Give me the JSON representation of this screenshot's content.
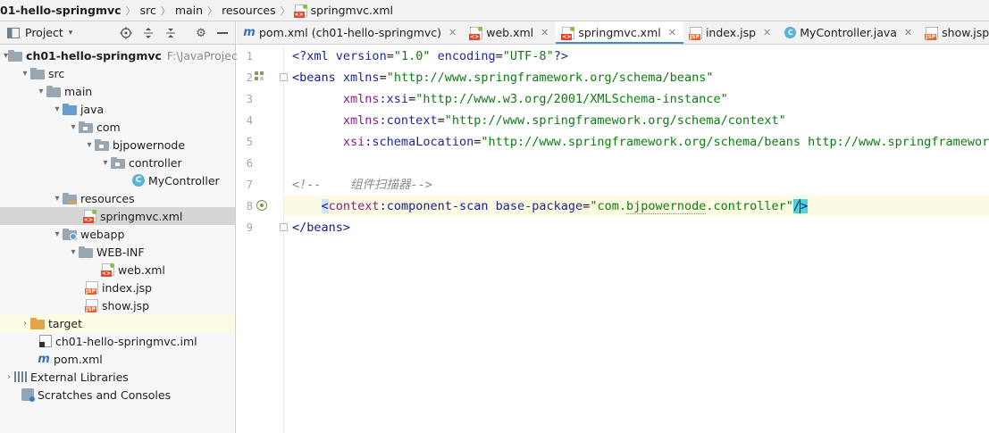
{
  "breadcrumbs": [
    {
      "label": "01-hello-springmvc",
      "icon": "module-folder-icon"
    },
    {
      "label": "src"
    },
    {
      "label": "main"
    },
    {
      "label": "resources"
    },
    {
      "label": "springmvc.xml",
      "icon": "xml-file-icon"
    }
  ],
  "project_panel": {
    "title": "Project",
    "toolbar_icons": [
      "locate-icon",
      "expand-all-icon",
      "collapse-all-icon",
      "settings-gear-icon",
      "hide-icon"
    ],
    "tree": [
      {
        "label": "ch01-hello-springmvc",
        "suffix": "F:\\JavaProject\\",
        "icon": "module-folder-icon",
        "depth": 0,
        "expanded": true,
        "bold": true
      },
      {
        "label": "src",
        "icon": "folder-icon",
        "depth": 1,
        "expanded": true
      },
      {
        "label": "main",
        "icon": "folder-icon",
        "depth": 2,
        "expanded": true
      },
      {
        "label": "java",
        "icon": "source-folder-icon",
        "depth": 3,
        "expanded": true
      },
      {
        "label": "com",
        "icon": "package-icon",
        "depth": 4,
        "expanded": true
      },
      {
        "label": "bjpowernode",
        "icon": "package-icon",
        "depth": 5,
        "expanded": true
      },
      {
        "label": "controller",
        "icon": "package-icon",
        "depth": 6,
        "expanded": true
      },
      {
        "label": "MyController",
        "icon": "java-class-icon",
        "depth": 7
      },
      {
        "label": "resources",
        "icon": "resources-folder-icon",
        "depth": 3,
        "expanded": true
      },
      {
        "label": "springmvc.xml",
        "icon": "xml-file-icon",
        "depth": 4,
        "selected": true
      },
      {
        "label": "webapp",
        "icon": "web-folder-icon",
        "depth": 3,
        "expanded": true
      },
      {
        "label": "WEB-INF",
        "icon": "folder-icon",
        "depth": 4,
        "expanded": true
      },
      {
        "label": "web.xml",
        "icon": "xml-file-icon",
        "depth": 5
      },
      {
        "label": "index.jsp",
        "icon": "jsp-file-icon",
        "depth": 4
      },
      {
        "label": "show.jsp",
        "icon": "jsp-file-icon",
        "depth": 4
      },
      {
        "label": "target",
        "icon": "excluded-folder-icon",
        "depth": 1,
        "expanded": false
      },
      {
        "label": "ch01-hello-springmvc.iml",
        "icon": "iml-file-icon",
        "depth": 1
      },
      {
        "label": "pom.xml",
        "icon": "maven-icon",
        "depth": 1
      },
      {
        "label": "External Libraries",
        "icon": "libraries-icon",
        "depth": 0,
        "expanded": false
      },
      {
        "label": "Scratches and Consoles",
        "icon": "scratches-icon",
        "depth": 0
      }
    ]
  },
  "editor_tabs": [
    {
      "label": "pom.xml (ch01-hello-springmvc)",
      "icon": "maven-icon"
    },
    {
      "label": "web.xml",
      "icon": "xml-file-icon"
    },
    {
      "label": "springmvc.xml",
      "icon": "xml-file-icon",
      "active": true
    },
    {
      "label": "index.jsp",
      "icon": "jsp-file-icon"
    },
    {
      "label": "MyController.java",
      "icon": "java-class-icon"
    },
    {
      "label": "show.jsp",
      "icon": "jsp-file-icon"
    }
  ],
  "tab_close_glyph": "✕",
  "editor": {
    "line_numbers": [
      "1",
      "2",
      "3",
      "4",
      "5",
      "6",
      "7",
      "8",
      "9"
    ],
    "lines": [
      "<?xml version=\"1.0\" encoding=\"UTF-8\"?>",
      "<beans xmlns=\"http://www.springframework.org/schema/beans\"",
      "       xmlns:xsi=\"http://www.w3.org/2001/XMLSchema-instance\"",
      "       xmlns:context=\"http://www.springframework.org/schema/context\"",
      "       xsi:schemaLocation=\"http://www.springframework.org/schema/beans http://www.springframework.",
      "",
      "<!--    组件扫描器-->",
      "    <context:component-scan base-package=\"com.bjpowernode.controller\"/>",
      "</beans>"
    ],
    "current_line": "8",
    "colors": {
      "tag": "#101a9a",
      "attribute_value": "#0b7d11",
      "namespace": "#891d8c",
      "comment": "#8a8a8a",
      "current_line_bg": "#fcfae3",
      "selection_tab_underline": "#4a88c7"
    }
  }
}
